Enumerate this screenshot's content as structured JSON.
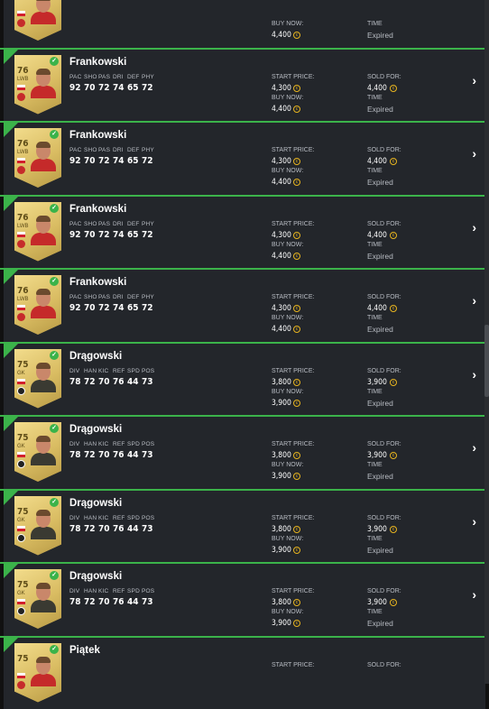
{
  "rows": [
    {
      "name": "",
      "rating": "",
      "position": "",
      "stat_labels": [],
      "stat_values": [],
      "start_price_label": "",
      "start_price": "",
      "buy_now_label": "BUY NOW:",
      "buy_now": "4,400",
      "sold_for_label": "",
      "sold_for": "",
      "time_label": "TIME",
      "status": "Expired",
      "club": "ev",
      "body": "red",
      "partial": "top"
    },
    {
      "name": "Frankowski",
      "rating": "76",
      "position": "LWB",
      "stat_labels": [
        "PAC",
        "SHO",
        "PAS",
        "DRI",
        "DEF",
        "PHY"
      ],
      "stat_values": [
        "92",
        "70",
        "72",
        "74",
        "65",
        "72"
      ],
      "start_price_label": "START PRICE:",
      "start_price": "4,300",
      "buy_now_label": "BUY NOW:",
      "buy_now": "4,400",
      "sold_for_label": "SOLD FOR:",
      "sold_for": "4,400",
      "time_label": "TIME",
      "status": "Expired",
      "club": "ev",
      "body": "red"
    },
    {
      "name": "Frankowski",
      "rating": "76",
      "position": "LWB",
      "stat_labels": [
        "PAC",
        "SHO",
        "PAS",
        "DRI",
        "DEF",
        "PHY"
      ],
      "stat_values": [
        "92",
        "70",
        "72",
        "74",
        "65",
        "72"
      ],
      "start_price_label": "START PRICE:",
      "start_price": "4,300",
      "buy_now_label": "BUY NOW:",
      "buy_now": "4,400",
      "sold_for_label": "SOLD FOR:",
      "sold_for": "4,400",
      "time_label": "TIME",
      "status": "Expired",
      "club": "ev",
      "body": "red"
    },
    {
      "name": "Frankowski",
      "rating": "76",
      "position": "LWB",
      "stat_labels": [
        "PAC",
        "SHO",
        "PAS",
        "DRI",
        "DEF",
        "PHY"
      ],
      "stat_values": [
        "92",
        "70",
        "72",
        "74",
        "65",
        "72"
      ],
      "start_price_label": "START PRICE:",
      "start_price": "4,300",
      "buy_now_label": "BUY NOW:",
      "buy_now": "4,400",
      "sold_for_label": "SOLD FOR:",
      "sold_for": "4,400",
      "time_label": "TIME",
      "status": "Expired",
      "club": "ev",
      "body": "red"
    },
    {
      "name": "Frankowski",
      "rating": "76",
      "position": "LWB",
      "stat_labels": [
        "PAC",
        "SHO",
        "PAS",
        "DRI",
        "DEF",
        "PHY"
      ],
      "stat_values": [
        "92",
        "70",
        "72",
        "74",
        "65",
        "72"
      ],
      "start_price_label": "START PRICE:",
      "start_price": "4,300",
      "buy_now_label": "BUY NOW:",
      "buy_now": "4,400",
      "sold_for_label": "SOLD FOR:",
      "sold_for": "4,400",
      "time_label": "TIME",
      "status": "Expired",
      "club": "ev",
      "body": "red"
    },
    {
      "name": "Drągowski",
      "rating": "75",
      "position": "GK",
      "stat_labels": [
        "DIV",
        "HAN",
        "KIC",
        "REF",
        "SPD",
        "POS"
      ],
      "stat_values": [
        "78",
        "72",
        "70",
        "76",
        "44",
        "73"
      ],
      "start_price_label": "START PRICE:",
      "start_price": "3,800",
      "buy_now_label": "BUY NOW:",
      "buy_now": "3,900",
      "sold_for_label": "SOLD FOR:",
      "sold_for": "3,900",
      "time_label": "TIME",
      "status": "Expired",
      "club": "ve",
      "body": "dark"
    },
    {
      "name": "Drągowski",
      "rating": "75",
      "position": "GK",
      "stat_labels": [
        "DIV",
        "HAN",
        "KIC",
        "REF",
        "SPD",
        "POS"
      ],
      "stat_values": [
        "78",
        "72",
        "70",
        "76",
        "44",
        "73"
      ],
      "start_price_label": "START PRICE:",
      "start_price": "3,800",
      "buy_now_label": "BUY NOW:",
      "buy_now": "3,900",
      "sold_for_label": "SOLD FOR:",
      "sold_for": "3,900",
      "time_label": "TIME",
      "status": "Expired",
      "club": "ve",
      "body": "dark"
    },
    {
      "name": "Drągowski",
      "rating": "75",
      "position": "GK",
      "stat_labels": [
        "DIV",
        "HAN",
        "KIC",
        "REF",
        "SPD",
        "POS"
      ],
      "stat_values": [
        "78",
        "72",
        "70",
        "76",
        "44",
        "73"
      ],
      "start_price_label": "START PRICE:",
      "start_price": "3,800",
      "buy_now_label": "BUY NOW:",
      "buy_now": "3,900",
      "sold_for_label": "SOLD FOR:",
      "sold_for": "3,900",
      "time_label": "TIME",
      "status": "Expired",
      "club": "ve",
      "body": "dark"
    },
    {
      "name": "Drągowski",
      "rating": "75",
      "position": "GK",
      "stat_labels": [
        "DIV",
        "HAN",
        "KIC",
        "REF",
        "SPD",
        "POS"
      ],
      "stat_values": [
        "78",
        "72",
        "70",
        "76",
        "44",
        "73"
      ],
      "start_price_label": "START PRICE:",
      "start_price": "3,800",
      "buy_now_label": "BUY NOW:",
      "buy_now": "3,900",
      "sold_for_label": "SOLD FOR:",
      "sold_for": "3,900",
      "time_label": "TIME",
      "status": "Expired",
      "club": "ve",
      "body": "dark"
    },
    {
      "name": "Piątek",
      "rating": "75",
      "position": "",
      "stat_labels": [],
      "stat_values": [],
      "start_price_label": "START PRICE:",
      "start_price": "",
      "buy_now_label": "",
      "buy_now": "",
      "sold_for_label": "SOLD FOR:",
      "sold_for": "",
      "time_label": "",
      "status": "",
      "club": "ev",
      "body": "red",
      "partial": "bottom"
    }
  ],
  "icons": {
    "coin": "coin-icon",
    "chevron": "chevron-right-icon",
    "check": "check-icon"
  },
  "colors": {
    "accent": "#3bb34a",
    "coin": "#e7b41f",
    "row_bg": "#23262b"
  }
}
